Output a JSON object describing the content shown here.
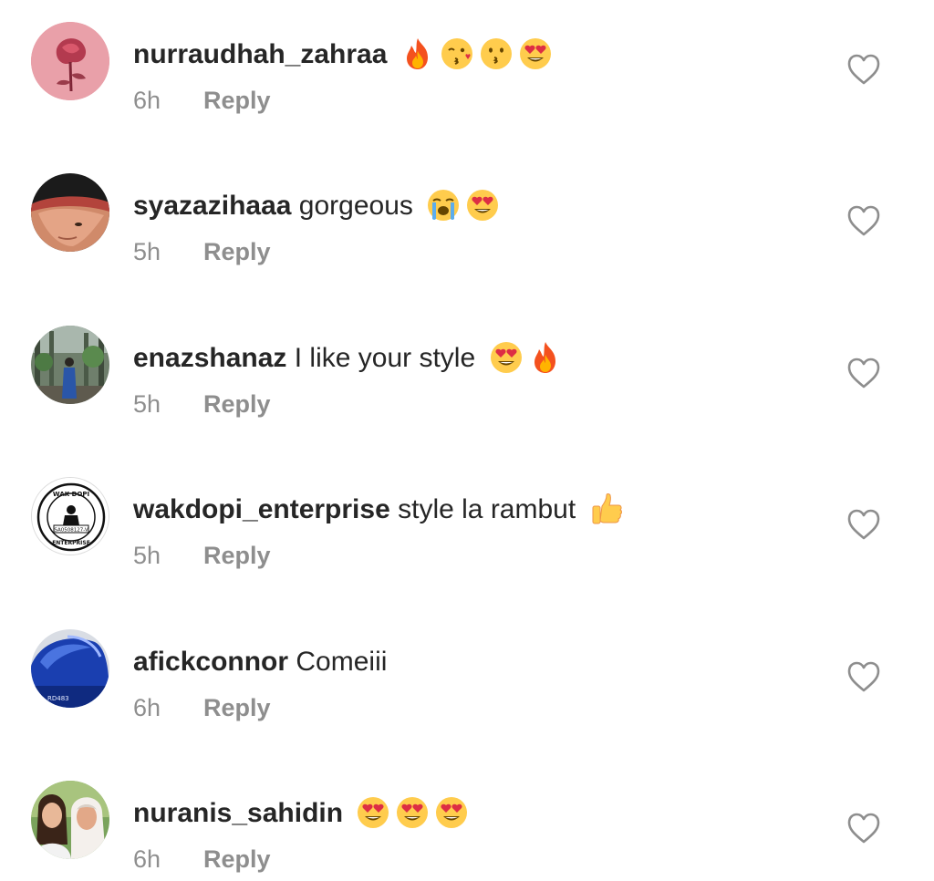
{
  "comments": [
    {
      "username": "nurraudhah_zahraa",
      "text": "",
      "emojis": [
        "fire-emoji",
        "kissing-wink-emoji",
        "kissing-emoji",
        "heart-eyes-emoji"
      ],
      "time": "6h",
      "reply_label": "Reply",
      "avatar": "rose-avatar"
    },
    {
      "username": "syazazihaaa",
      "text": "gorgeous",
      "emojis": [
        "loudly-crying-emoji",
        "heart-eyes-emoji"
      ],
      "time": "5h",
      "reply_label": "Reply",
      "avatar": "person-avatar"
    },
    {
      "username": "enazshanaz",
      "text": "I like your style",
      "emojis": [
        "heart-eyes-emoji",
        "fire-emoji"
      ],
      "time": "5h",
      "reply_label": "Reply",
      "avatar": "outdoor-avatar"
    },
    {
      "username": "wakdopi_enterprise",
      "text": "style la rambut",
      "emojis": [
        "thumbs-up-emoji"
      ],
      "time": "5h",
      "reply_label": "Reply",
      "avatar": "logo-avatar",
      "avatar_logo": {
        "top_text": "WAK DOPI",
        "bottom_text": "ENTERPRISE",
        "id_text": "SA0508127-V"
      }
    },
    {
      "username": "afickconnor",
      "text": "Comeiii",
      "emojis": [],
      "time": "6h",
      "reply_label": "Reply",
      "avatar": "helmet-avatar",
      "avatar_plate": "RD483"
    },
    {
      "username": "nuranis_sahidin",
      "text": "",
      "emojis": [
        "heart-eyes-emoji",
        "heart-eyes-emoji",
        "heart-eyes-emoji"
      ],
      "time": "6h",
      "reply_label": "Reply",
      "avatar": "two-people-avatar"
    }
  ],
  "colors": {
    "username": "#262626",
    "meta": "#8e8e8e",
    "like_outline": "#8e8e8e"
  }
}
